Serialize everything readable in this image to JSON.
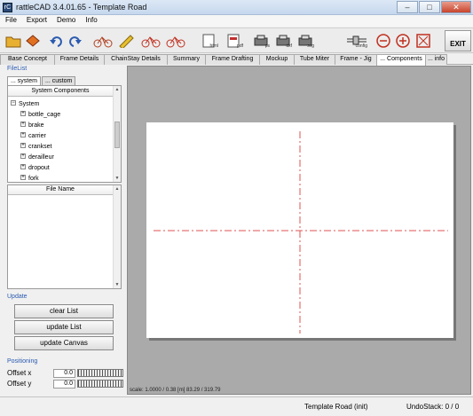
{
  "window": {
    "title": "rattleCAD  3.4.01.65 - Template Road",
    "app_icon": "rC",
    "minimize": "–",
    "maximize": "□",
    "close": "✕"
  },
  "menu": [
    "File",
    "Export",
    "Demo",
    "Info"
  ],
  "toolbar": {
    "exit_label": "EXIT",
    "icon_labels": {
      "html": "html",
      "pdf": "pdf",
      "ps": "ps",
      "dxf": "dxf",
      "svg": "svg",
      "config": "config"
    }
  },
  "tabs": [
    "Base Concept",
    "Frame Details",
    "ChainStay Details",
    "Summary",
    "Frame Drafting",
    "Mockup",
    "Tube Miter",
    "Frame - Jig",
    "... Components",
    "... info"
  ],
  "active_tab": "... Components",
  "filelist": {
    "label": "FileList",
    "subtabs": [
      "... system",
      "... custom"
    ],
    "tree_header": "System Components",
    "root": "System",
    "items": [
      "bottle_cage",
      "brake",
      "carrier",
      "crankset",
      "derailleur",
      "dropout",
      "fork"
    ],
    "file_header": "File Name"
  },
  "update": {
    "label": "Update",
    "buttons": [
      "clear List",
      "update List",
      "update Canvas"
    ]
  },
  "positioning": {
    "label": "Positioning",
    "rows": [
      {
        "label": "Offset x",
        "value": "0.0"
      },
      {
        "label": "Offset y",
        "value": "0.0"
      }
    ]
  },
  "canvas": {
    "scale_text": "scale: 1.0000 / 0.38  [m]  83.29 / 319.79"
  },
  "status": {
    "document": "Template Road (init)",
    "undo": "UndoStack:  0 / 0"
  }
}
